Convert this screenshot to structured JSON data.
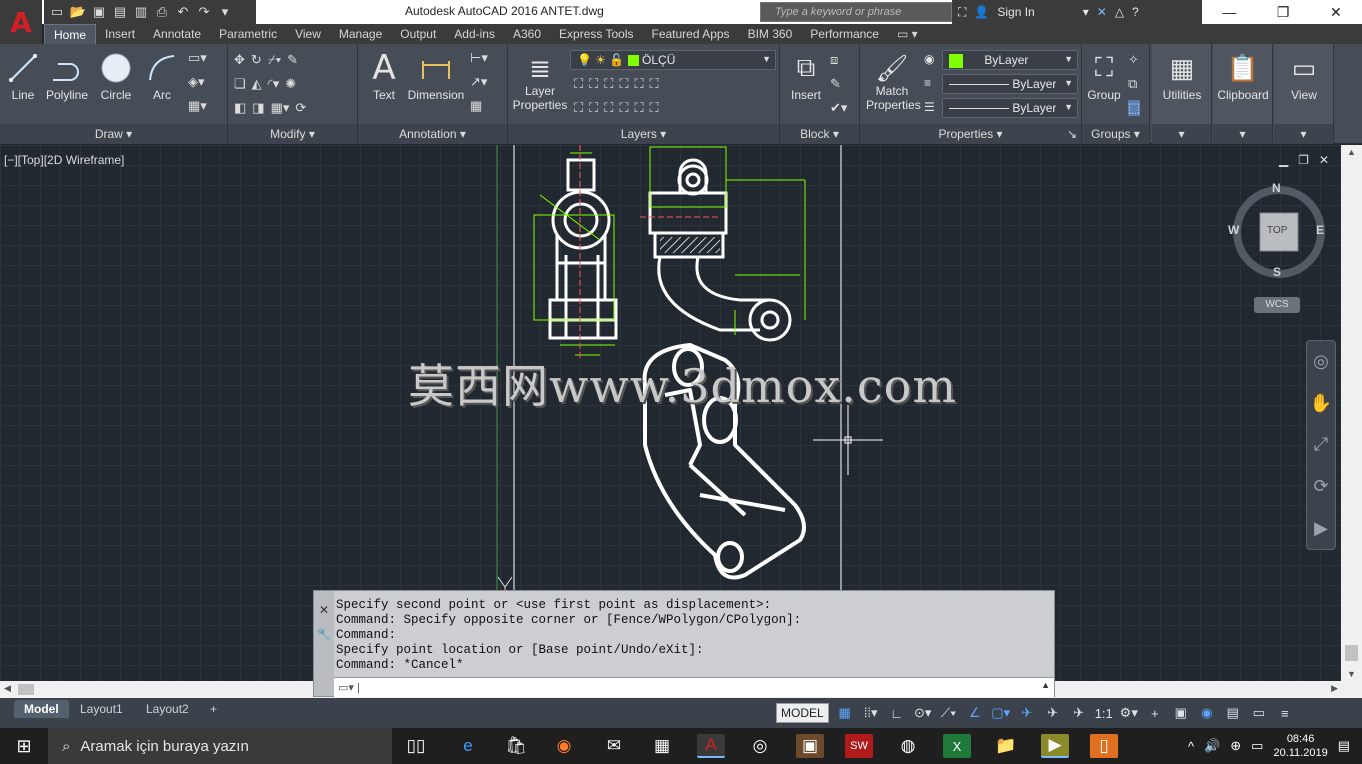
{
  "window": {
    "title": "Autodesk AutoCAD 2016    ANTET.dwg",
    "search_placeholder": "Type a keyword or phrase",
    "sign_in": "Sign In"
  },
  "ribbon_tabs": [
    "Home",
    "Insert",
    "Annotate",
    "Parametric",
    "View",
    "Manage",
    "Output",
    "Add-ins",
    "A360",
    "Express Tools",
    "Featured Apps",
    "BIM 360",
    "Performance"
  ],
  "ribbon": {
    "draw": {
      "title": "Draw",
      "line": "Line",
      "polyline": "Polyline",
      "circle": "Circle",
      "arc": "Arc"
    },
    "modify": {
      "title": "Modify"
    },
    "annotation": {
      "title": "Annotation",
      "text": "Text",
      "dimension": "Dimension"
    },
    "layers": {
      "title": "Layers",
      "layer_properties_1": "Layer",
      "layer_properties_2": "Properties",
      "current_layer": "ÖLÇÜ"
    },
    "block": {
      "title": "Block",
      "insert": "Insert"
    },
    "properties": {
      "title": "Properties",
      "match_1": "Match",
      "match_2": "Properties",
      "color": "ByLayer",
      "linetype": "ByLayer",
      "lineweight": "ByLayer"
    },
    "groups": {
      "title": "Groups",
      "group": "Group"
    },
    "utilities": "Utilities",
    "clipboard": "Clipboard",
    "view": "View"
  },
  "viewport": {
    "label": "[−][Top][2D Wireframe]",
    "watermark": "莫西网www.3dmox.com",
    "viewcube": {
      "n": "N",
      "s": "S",
      "e": "E",
      "w": "W",
      "face": "TOP",
      "wcs": "WCS"
    }
  },
  "command": {
    "history": [
      "Specify second point or <use first point as displacement>:",
      "Command: Specify opposite corner or [Fence/WPolygon/CPolygon]:",
      "Command:",
      "Specify point location or [Base point/Undo/eXit]:",
      "Command: *Cancel*"
    ]
  },
  "layout_tabs": [
    "Model",
    "Layout1",
    "Layout2"
  ],
  "status": {
    "model": "MODEL",
    "scale": "1:1"
  },
  "taskbar": {
    "search": "Aramak için buraya yazın",
    "time": "08:46",
    "date": "20.11.2019"
  },
  "colors": {
    "accent_green": "#7fff00",
    "drawing_white": "#ffffff",
    "canvas_bg": "#212830"
  }
}
